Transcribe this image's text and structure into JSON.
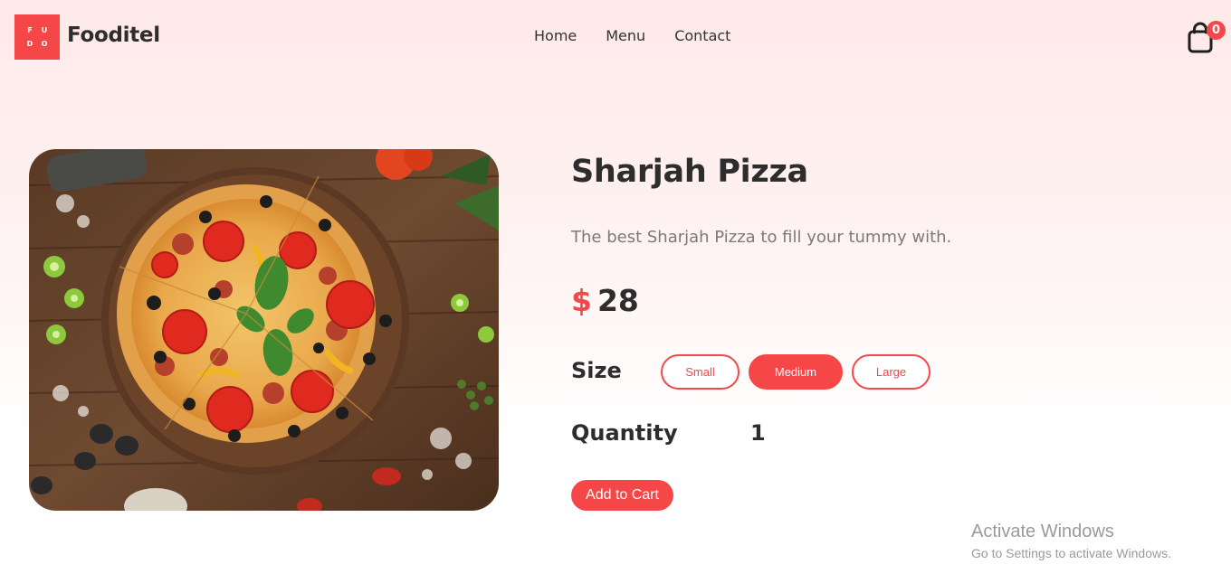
{
  "header": {
    "logo_letters": [
      "F",
      "U",
      "D",
      "O"
    ],
    "brand": "Fooditel",
    "nav": [
      "Home",
      "Menu",
      "Contact"
    ],
    "cart_count": "0"
  },
  "product": {
    "image_alt": "pizza-photo",
    "name": "Sharjah Pizza",
    "description": "The best Sharjah Pizza to fill your tummy with.",
    "currency": "$",
    "price": "28",
    "size_label": "Size",
    "sizes": [
      "Small",
      "Medium",
      "Large"
    ],
    "selected_size": "Medium",
    "quantity_label": "Quantity",
    "quantity": "1",
    "add_to_cart": "Add to Cart"
  },
  "watermark": {
    "title": "Activate Windows",
    "subtitle": "Go to Settings to activate Windows."
  },
  "colors": {
    "accent": "#f54748",
    "text_dark": "#2d2d2d",
    "text_muted": "#7a7a7a"
  }
}
